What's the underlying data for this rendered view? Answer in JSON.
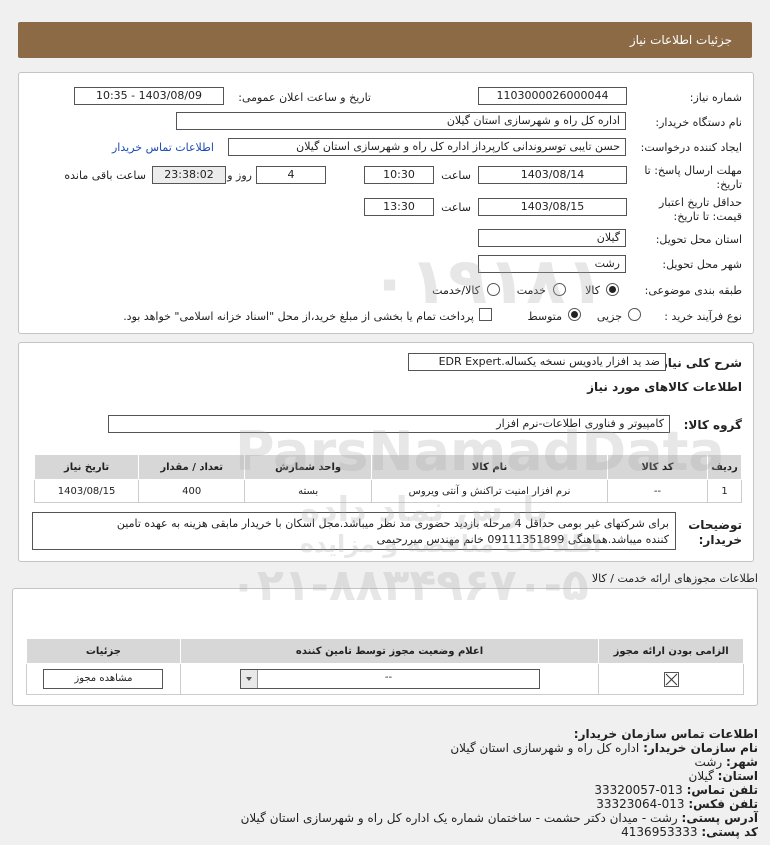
{
  "header": {
    "title": "جزئیات اطلاعات نیاز"
  },
  "info": {
    "need_number_label": "شماره نیاز:",
    "need_number": "1103000026000044",
    "announce_label": "تاریخ و ساعت اعلان عمومی:",
    "announce_value": "1403/08/09 - 10:35",
    "buyer_label": "نام دستگاه خریدار:",
    "buyer_value": "اداره کل راه و شهرسازی استان گیلان",
    "creator_label": "ایجاد کننده درخواست:",
    "creator_value": "حسن تایبی توسروندانی کارپرداز اداره کل راه و شهرسازی استان گیلان",
    "contact_link": "اطلاعات تماس خریدار",
    "deadline_label_1": "مهلت ارسال پاسخ: تا",
    "deadline_label_2": "تاریخ:",
    "deadline_date": "1403/08/14",
    "time_label": "ساعت",
    "deadline_time": "10:30",
    "days_value": "4",
    "days_label": "روز و",
    "remaining_time": "23:38:02",
    "remaining_label": "ساعت باقی مانده",
    "validity_label_1": "حداقل تاریخ اعتبار",
    "validity_label_2": "قیمت: تا تاریخ:",
    "validity_date": "1403/08/15",
    "validity_time": "13:30",
    "province_label": "استان محل تحویل:",
    "province_value": "گیلان",
    "city_label": "شهر محل تحویل:",
    "city_value": "رشت",
    "category_label": "طبقه بندی موضوعی:",
    "category_options": [
      "کالا",
      "خدمت",
      "کالا/خدمت"
    ],
    "process_label": "نوع فرآیند خرید :",
    "process_options": [
      "جزیی",
      "متوسط"
    ],
    "payment_note": "پرداخت تمام یا بخشی از مبلغ خرید،از محل \"اسناد خزانه اسلامی\" خواهد بود."
  },
  "summary": {
    "label": "شرح کلی نیاز:",
    "value": "ضد ید افزار یادویس نسخه یکساله.EDR Expert",
    "goods_title": "اطلاعات کالاهای مورد نیاز",
    "group_label": "گروه کالا:",
    "group_value": "کامپیوتر و فناوری اطلاعات-نرم افزار"
  },
  "goods_table": {
    "headers": [
      "ردیف",
      "کد کالا",
      "نام کالا",
      "واحد شمارش",
      "تعداد / مقدار",
      "تاریخ نیاز"
    ],
    "rows": [
      [
        "1",
        "--",
        "نرم افزار امنیت تراکنش و آنتی ویروس",
        "بسته",
        "400",
        "1403/08/15"
      ]
    ]
  },
  "notes": {
    "label_1": "توضیحات",
    "label_2": "خریدار:",
    "line_1": "برای شرکتهای غیر بومی حداقل 4 مرحله بازدید حضوری مد نظر میباشد.مجل اسکان با خریدار مابقی هزینه به عهده تامین",
    "line_2": "کننده میباشد.هماهنگی 09111351899 خانم مهندس میررحیمی"
  },
  "license": {
    "title": "اطلاعات مجوزهای ارائه خدمت / کالا",
    "headers": [
      "الزامی بودن ارائه مجوز",
      "اعلام وضعیت مجوز توسط تامین کننده",
      "جزئیات"
    ],
    "select_value": "--",
    "view_button": "مشاهده مجوز"
  },
  "contact": {
    "title": "اطلاعات تماس سازمان خریدار:",
    "org_label": "نام سازمان خریدار:",
    "org_value": "اداره کل راه و شهرسازی استان گیلان",
    "city_label": "شهر:",
    "city_value": "رشت",
    "province_label": "استان:",
    "province_value": "گیلان",
    "phone_label": "تلفن تماس:",
    "phone_value": "013-33320057",
    "fax_label": "تلفن فکس:",
    "fax_value": "013-33323064",
    "address_label": "آدرس پستی:",
    "address_value": "رشت - میدان دکتر حشمت - ساختمان شماره یک اداره کل راه و شهرسازی استان گیلان",
    "postal_label": "کد پستی:",
    "postal_value": "4136953333"
  },
  "watermark": {
    "brand": "ParsNamadData",
    "persian": "پارس نماد داده",
    "sub": "اطلاعات مناقصه و مزایده",
    "phone": "۰۲۱-۸۸۳۴۹۶۷۰-۵",
    "digits": "۰۱۹۱۸۱"
  }
}
